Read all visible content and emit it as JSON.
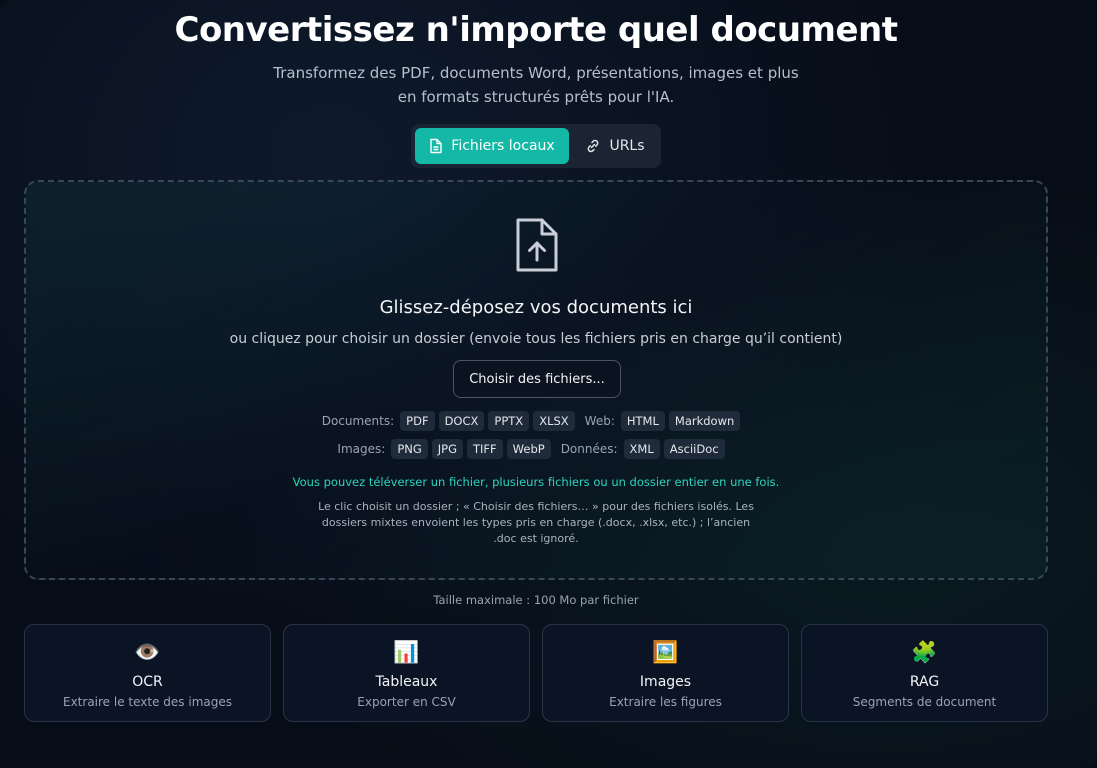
{
  "header": {
    "title": "Convertissez n'importe quel document",
    "subtitle": "Transformez des PDF, documents Word, présentations, images et plus en formats structurés prêts pour l'IA."
  },
  "tabs": [
    {
      "label": "Fichiers locaux",
      "icon": "file-icon",
      "active": true
    },
    {
      "label": "URLs",
      "icon": "link-icon",
      "active": false
    }
  ],
  "dropzone": {
    "icon": "file-upload-icon",
    "title": "Glissez-déposez vos documents ici",
    "subtitle": "ou cliquez pour choisir un dossier (envoie tous les fichiers pris en charge qu’il contient)",
    "choose_button": "Choisir des fichiers...",
    "formats_row1": {
      "documents_label": "Documents:",
      "documents": [
        "PDF",
        "DOCX",
        "PPTX",
        "XLSX"
      ],
      "web_label": "Web:",
      "web": [
        "HTML",
        "Markdown"
      ]
    },
    "formats_row2": {
      "images_label": "Images:",
      "images": [
        "PNG",
        "JPG",
        "TIFF",
        "WebP"
      ],
      "data_label": "Données:",
      "data": [
        "XML",
        "AsciiDoc"
      ]
    },
    "hint": "Vous pouvez téléverser un fichier, plusieurs fichiers ou un dossier entier en une fois.",
    "note": "Le clic choisit un dossier ; « Choisir des fichiers… » pour des fichiers isolés. Les dossiers mixtes envoient les types pris en charge (.docx, .xlsx, etc.) ; l’ancien .doc est ignoré."
  },
  "max_size": "Taille maximale : 100 Mo par fichier",
  "features": [
    {
      "emoji": "👁️",
      "icon": "eye-icon",
      "title": "OCR",
      "desc": "Extraire le texte des images"
    },
    {
      "emoji": "📊",
      "icon": "bar-chart-icon",
      "title": "Tableaux",
      "desc": "Exporter en CSV"
    },
    {
      "emoji": "🖼️",
      "icon": "picture-icon",
      "title": "Images",
      "desc": "Extraire les figures"
    },
    {
      "emoji": "🧩",
      "icon": "puzzle-icon",
      "title": "RAG",
      "desc": "Segments de document"
    }
  ],
  "colors": {
    "accent": "#14b8a6",
    "hint_text": "#2dd4bf",
    "background": "#070d18"
  }
}
